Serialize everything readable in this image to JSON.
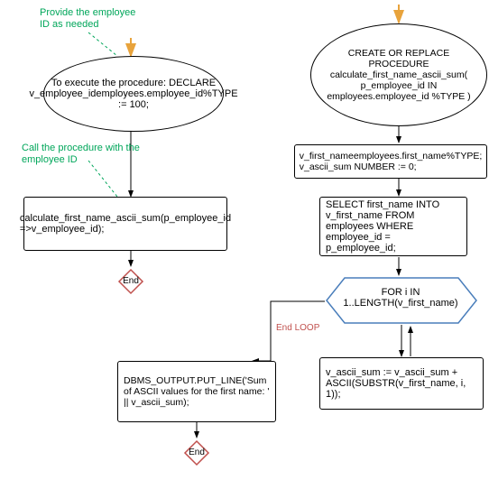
{
  "annotations": {
    "provide_id": "Provide the employee ID as needed",
    "call_procedure": "Call the procedure with the employee ID"
  },
  "left_flow": {
    "declare": "To execute the procedure: DECLARE v_employee_idemployees.employee_id%TYPE := 100;",
    "call": "calculate_first_name_ascii_sum(p_employee_id =>v_employee_id);",
    "end": "End"
  },
  "right_flow": {
    "procedure": "CREATE OR REPLACE PROCEDURE calculate_first_name_ascii_sum( p_employee_id IN employees.employee_id %TYPE )",
    "vars": "v_first_nameemployees.first_name%TYPE; v_ascii_sum NUMBER := 0;",
    "select": "SELECT first_name INTO v_first_name FROM employees WHERE employee_id = p_employee_id;",
    "loop": "FOR i IN 1..LENGTH(v_first_name)",
    "loop_body": "v_ascii_sum := v_ascii_sum + ASCII(SUBSTR(v_first_name, i, 1));",
    "end_loop": "End LOOP",
    "output": "DBMS_OUTPUT.PUT_LINE('Sum of ASCII values for the first name: ' || v_ascii_sum);",
    "end": "End"
  }
}
